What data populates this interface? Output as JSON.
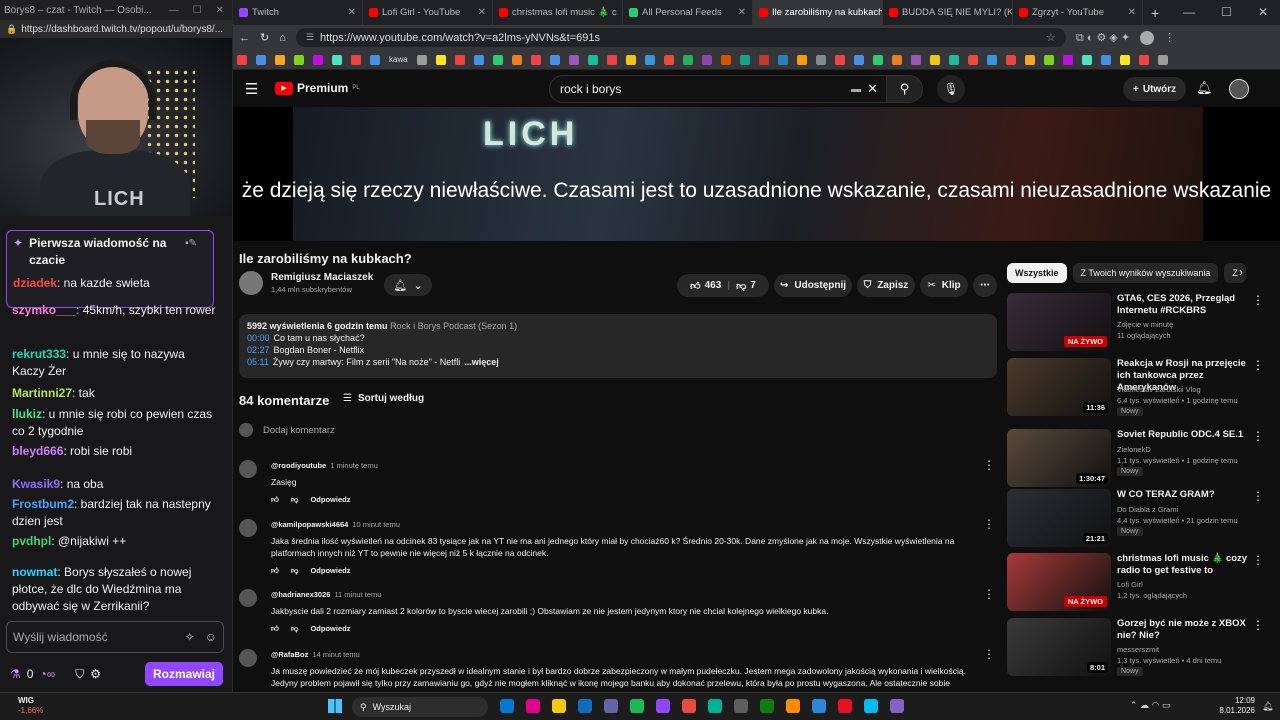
{
  "twitch": {
    "titlebar": "Borys8 – czat - Twitch — Osobi...",
    "url": "https://dashboard.twitch.tv/popout/u/borys8/...",
    "stream_logo": "LICH",
    "pinned_title": "Pierwsza wiadomość na czacie",
    "pinned_user": "dziadek",
    "pinned_text": ": na kazde swieta",
    "messages": [
      {
        "user": "szymko___",
        "color": "#ff7ad9",
        "text": ": 45km/h, szybki ten rower"
      },
      {
        "user": "rekrut333",
        "color": "#1fd8b6",
        "text": ": u mnie się to nazywa Kaczy Żer"
      },
      {
        "user": "Martinni27",
        "color": "#b3e35a",
        "text": ": tak"
      },
      {
        "user": "llukiz",
        "color": "#4be38a",
        "text": ": u mnie się robi co pewien czas co 2 tygodnie"
      },
      {
        "user": "bleyd666",
        "color": "#d27dff",
        "text": ": robi sie robi"
      },
      {
        "user": "Kwasik9",
        "color": "#8a6cff",
        "text": ": na oba"
      },
      {
        "user": "Frostbum2",
        "color": "#4aa3ff",
        "text": ": bardziej tak na nastepny dzien jest"
      },
      {
        "user": "pvdhpl",
        "color": "#3fd66b",
        "text": ": @nijakiwi ++"
      },
      {
        "user": "nowmat",
        "color": "#2fd2ff",
        "text": ": Borys słyszałeś o nowej płotce, że dlc do Wiedźmina ma odbywać się w Zerrikanii?"
      }
    ],
    "input_placeholder": "Wyślij wiadomość",
    "points": "0",
    "chat_button": "Rozmawiaj"
  },
  "tabs": [
    {
      "label": "Twitch",
      "color": "#9147ff"
    },
    {
      "label": "Lofi Girl - YouTube",
      "color": "#ff0000"
    },
    {
      "label": "christmas lofi music 🎄 c",
      "color": "#ff0000"
    },
    {
      "label": "All Personal Feeds",
      "color": "#2ecc71"
    },
    {
      "label": "Ile zarobiliśmy na kubkach?",
      "color": "#ff0000"
    },
    {
      "label": "BUDDA SIĘ NIE MYLI? (Kon",
      "color": "#ff0000"
    },
    {
      "label": "Zgrzyt - YouTube",
      "color": "#ff0000"
    }
  ],
  "address_url": "https://www.youtube.com/watch?v=a2lms-yNVNs&t=691s",
  "bookmark_label": "kawa",
  "bookmark_colors": [
    "#e44",
    "#4a90e2",
    "#f5a623",
    "#7ed321",
    "#bd10e0",
    "#50e3c2",
    "#e44",
    "#4a90e2",
    "#9b9b9b",
    "#f8e71c",
    "#e44",
    "#4a90e2",
    "#2ecc71",
    "#e67e22",
    "#e44",
    "#4a90e2",
    "#9b59b6",
    "#1abc9c",
    "#e44",
    "#f1c40f",
    "#3498db",
    "#e74c3c",
    "#27ae60",
    "#8e44ad",
    "#d35400",
    "#16a085",
    "#c0392b",
    "#2980b9",
    "#f39c12",
    "#7f8c8d",
    "#e44",
    "#4a90e2",
    "#2ecc71",
    "#e67e22",
    "#9b59b6",
    "#f1c40f",
    "#1abc9c",
    "#e74c3c",
    "#3498db",
    "#e44",
    "#f5a623",
    "#7ed321",
    "#bd10e0",
    "#50e3c2",
    "#4a90e2",
    "#f8e71c",
    "#e44",
    "#9b9b9b"
  ],
  "yt": {
    "logo": "Premium",
    "logo_sup": "PL",
    "search_value": "rock i borys",
    "create": "Utwórz",
    "caption": "że dzieją się rzeczy niewłaściwe. Czasami jest to uzasadnione wskazanie, czasami nieuzasadnione wskazanie",
    "title": "Ile zarobiliśmy na kubkach?",
    "channel": "Remigiusz Maciaszek",
    "subs": "1,44 mln subskrybentów",
    "likes": "463",
    "dislikes": "7",
    "share": "Udostępnij",
    "save": "Zapisz",
    "clip": "Klip",
    "desc_views": "5992 wyświetlenia  6 godzin temu",
    "desc_playlist": "Rock i Borys Podcast (Sezon 1)",
    "chapters": [
      {
        "t": "00:00",
        "label": "Co tam u nas słychać?"
      },
      {
        "t": "02:27",
        "label": "Bogdan Boner - Netflix"
      },
      {
        "t": "05:11",
        "label": "Żywy czy martwy: Film z serii \"Na noże\" - Netfli"
      }
    ],
    "more": "...więcej",
    "comments_count": "84 komentarze",
    "sort": "Sortuj według",
    "add_comment": "Dodaj komentarz",
    "reply": "Odpowiedz",
    "comments": [
      {
        "author": "@roodiyoutube",
        "time": "1 minutę temu",
        "text": "Zasięg"
      },
      {
        "author": "@kamilpopawski4664",
        "time": "10 minut temu",
        "text": "Jaka średnia ilość wyświetleń na odcinek 83 tysiące jak na YT nie ma ani jednego który miał by chociaż60 k? Średnio 20-30k. Dane zmyślone jak na moje. Wszystkie wyświetlenia na platformach innych niż YT to pewnie nie więcej niż 5 k łącznie na odcinek."
      },
      {
        "author": "@hadrianex3026",
        "time": "11 minut temu",
        "text": "Jakbyscie dali 2 rozmiary zamiast 2 kolorów to byscie wiecej zarobili ;) Obstawiam ze nie jestem jedynym ktory nie chcial kolejnego wielkiego kubka."
      },
      {
        "author": "@RafaBoz",
        "time": "14 minut temu",
        "text": "Ja muszę powiedzieć że mój kubeczek przyszedł w idealnym stanie i był bardzo dobrze zabezpieczony w małym pudełeczku. Jestem mega zadowolony jakością wykonania i wielkością. Jedyny problem pojawił się tylko przy zamawianiu go, gdyż nie mogłem kliknąć w ikonę mojego banku aby dokonać przelewu, która była po prostu wygaszona. Ale ostatecznie sobie"
      }
    ],
    "chips": [
      "Wszystkie",
      "Z Twoich wyników wyszukiwania",
      "Z"
    ],
    "related": [
      {
        "title": "GTA6, CES 2026, Przegląd Internetu #RCKBRS",
        "channel": "Zdjęcie w minutę",
        "stats": "11 oglądających",
        "badge": "NA ŻYWO",
        "thumb": "#3a2a3a",
        "new": ""
      },
      {
        "title": "Reakcja w Rosji na przejęcie ich tankowca przez Amerykanów",
        "channel": "Viacheslav Zarutskii Vlog",
        "stats": "6,4 tys. wyświetleń • 1 godzinę temu",
        "badge": "11:36",
        "thumb": "#4a3a2a",
        "new": "Nowy"
      },
      {
        "title": "Soviet Republic ODC.4 SE.1",
        "channel": "ZielonekD",
        "stats": "1,1 tys. wyświetleń • 1 godzinę temu",
        "badge": "1:30:47",
        "thumb": "#5a4a3a",
        "new": "Nowy"
      },
      {
        "title": "W CO TERAZ GRAM?",
        "channel": "Do Diabla z Grami",
        "stats": "4,4 tys. wyświetleń • 21 godzin temu",
        "badge": "21:21",
        "thumb": "#2a2e34",
        "new": "Nowy"
      },
      {
        "title": "christmas lofi music 🎄 cozy radio to get festive to",
        "channel": "Lofi Girl",
        "stats": "1,2 tys. oglądających",
        "badge": "NA ŻYWO",
        "thumb": "#a83a3a",
        "new": ""
      },
      {
        "title": "Gorzej być nie może z XBOX nie? Nie?",
        "channel": "messerszmit",
        "stats": "1,3 tys. wyświetleń • 4 dni temu",
        "badge": "8:01",
        "thumb": "#3a3a3a",
        "new": "Nowy"
      }
    ]
  },
  "taskbar": {
    "ticker": "WIG",
    "ticker_change": "-1,66%",
    "search": "Wyszukaj",
    "time": "12:09",
    "date": "8.01.2026",
    "icon_colors": [
      "#0078d4",
      "#e3008c",
      "#f2c811",
      "#0f6cbd",
      "#6264a7",
      "#1db954",
      "#9147ff",
      "#e74c3c",
      "#00b294",
      "#5e5e5e",
      "#107c10",
      "#ff8c00",
      "#2b88d8",
      "#e81123",
      "#00bcf2",
      "#8661c5"
    ]
  }
}
